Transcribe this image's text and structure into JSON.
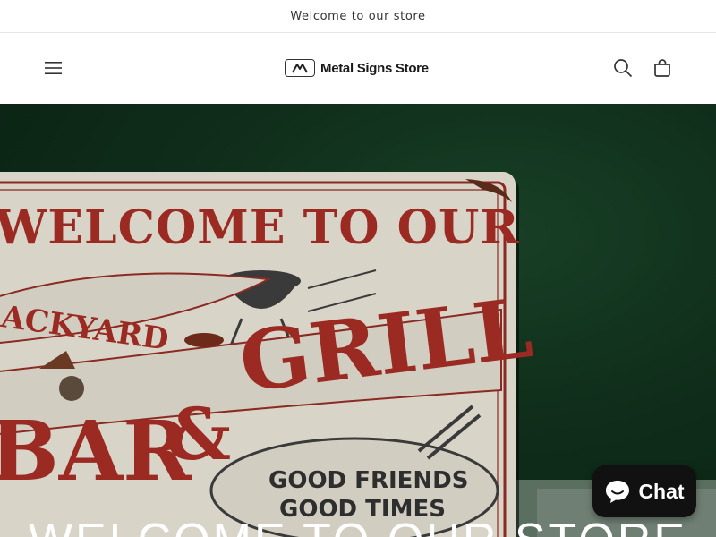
{
  "announcement": {
    "text": "Welcome to our store"
  },
  "header": {
    "logo_text": "Metal Signs Store",
    "menu_icon": "hamburger-menu-icon",
    "search_icon": "search-icon",
    "cart_icon": "cart-icon"
  },
  "hero": {
    "sign_title_line1": "WELCOME TO OUR",
    "sign_word_backyard": "BACKYARD",
    "sign_word_bar": "BAR",
    "sign_amp": "&",
    "sign_word_grill": "GRILL",
    "sign_tagline_1": "GOOD FRIENDS",
    "sign_tagline_2": "GOOD TIMES",
    "caption": "WELCOME TO OUR STORE"
  },
  "chat": {
    "label": "Chat",
    "icon": "chat-bubble-icon"
  },
  "colors": {
    "hero_bg": "#0f2d1a",
    "sign_red": "#9b2a22",
    "sign_plate": "#d9d4c8",
    "chat_bg": "#111111"
  }
}
